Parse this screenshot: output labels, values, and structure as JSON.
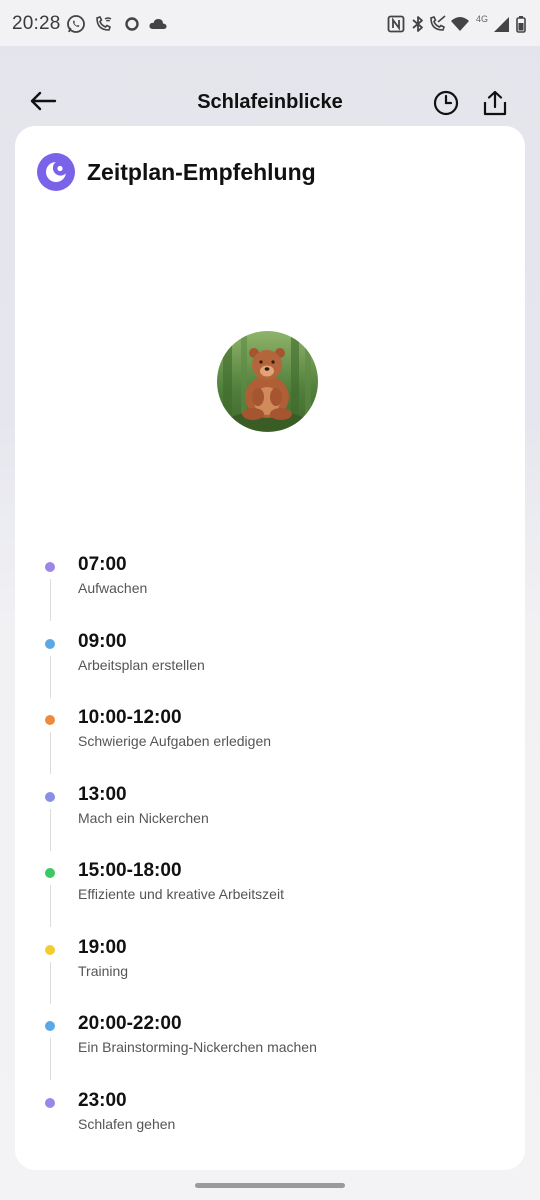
{
  "status_bar": {
    "time": "20:28",
    "network": "4G"
  },
  "header": {
    "title": "Schlafeinblicke"
  },
  "card": {
    "title": "Zeitplan-Empfehlung",
    "icon_color": "#7a63e9"
  },
  "schedule": [
    {
      "time": "07:00",
      "label": "Aufwachen",
      "color": "#9b87e8"
    },
    {
      "time": "09:00",
      "label": "Arbeitsplan erstellen",
      "color": "#5aa9e6"
    },
    {
      "time": "10:00-12:00",
      "label": "Schwierige Aufgaben erledigen",
      "color": "#ef8a3c"
    },
    {
      "time": "13:00",
      "label": "Mach ein Nickerchen",
      "color": "#8a8fe6"
    },
    {
      "time": "15:00-18:00",
      "label": "Effiziente und kreative Arbeitszeit",
      "color": "#3cc864"
    },
    {
      "time": "19:00",
      "label": "Training",
      "color": "#f2cd2f"
    },
    {
      "time": "20:00-22:00",
      "label": "Ein Brainstorming-Nickerchen machen",
      "color": "#5aa9e6"
    },
    {
      "time": "23:00",
      "label": "Schlafen gehen",
      "color": "#9b87e8"
    }
  ]
}
